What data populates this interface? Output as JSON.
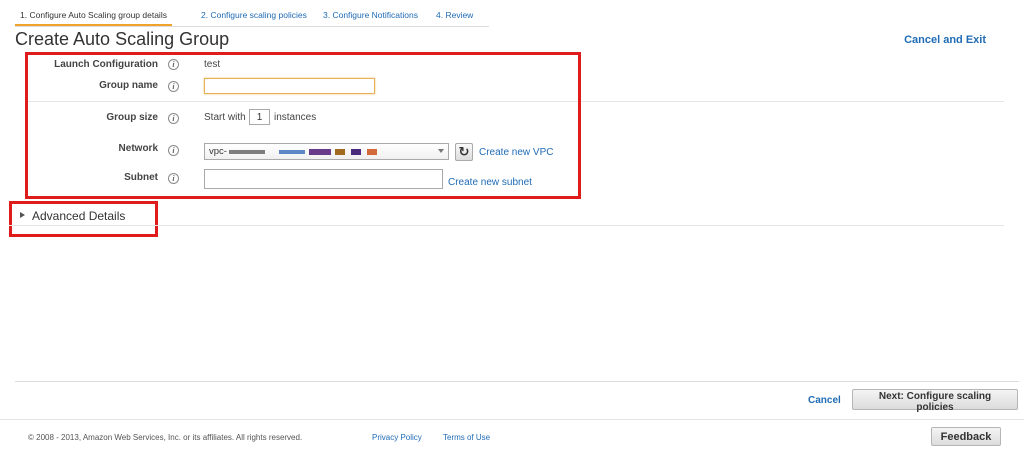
{
  "wizard": {
    "steps": [
      {
        "label": "1. Configure Auto Scaling group details",
        "active": true
      },
      {
        "label": "2. Configure scaling policies",
        "active": false
      },
      {
        "label": "3. Configure Notifications",
        "active": false
      },
      {
        "label": "4. Review",
        "active": false
      }
    ]
  },
  "header": {
    "title": "Create Auto Scaling Group",
    "cancel_exit": "Cancel and Exit"
  },
  "form": {
    "launch_configuration": {
      "label": "Launch Configuration",
      "value": "test"
    },
    "group_name": {
      "label": "Group name",
      "value": ""
    },
    "group_size": {
      "label": "Group size",
      "prefix": "Start with",
      "value": "1",
      "suffix": "instances"
    },
    "network": {
      "label": "Network",
      "selected_prefix": "vpc-",
      "create_link": "Create new VPC"
    },
    "subnet": {
      "label": "Subnet",
      "value": "",
      "create_link": "Create new subnet"
    }
  },
  "advanced": {
    "label": "Advanced Details"
  },
  "actions": {
    "cancel": "Cancel",
    "next": "Next: Configure scaling policies"
  },
  "footer": {
    "copyright": "© 2008 - 2013, Amazon Web Services, Inc. or its affiliates. All rights reserved.",
    "privacy": "Privacy Policy",
    "terms": "Terms of Use",
    "feedback": "Feedback"
  },
  "colors": {
    "link": "#1f6bb5",
    "active_step_underline": "#f0a32a",
    "annotation_red": "#e01b1b"
  },
  "icons": [
    "info-icon",
    "refresh-icon",
    "chevron-down-icon",
    "caret-right-icon"
  ]
}
